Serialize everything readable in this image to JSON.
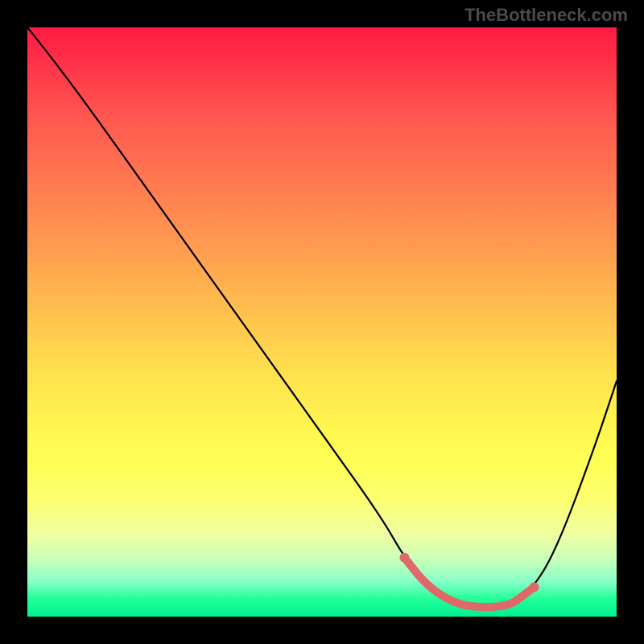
{
  "watermark": "TheBottleneck.com",
  "chart_data": {
    "type": "line",
    "title": "",
    "xlabel": "",
    "ylabel": "",
    "xlim": [
      0,
      100
    ],
    "ylim": [
      0,
      100
    ],
    "series": [
      {
        "name": "curve",
        "x": [
          0,
          4,
          10,
          20,
          30,
          40,
          50,
          60,
          64,
          68,
          73,
          78,
          82,
          86,
          90,
          96,
          100
        ],
        "y": [
          100,
          95,
          87,
          73,
          59,
          45,
          31,
          17,
          10,
          5,
          2,
          1.5,
          2,
          5,
          12,
          28,
          40
        ]
      },
      {
        "name": "highlight",
        "x": [
          64,
          68,
          73,
          78,
          82,
          84,
          86
        ],
        "y": [
          10,
          5,
          2,
          1.5,
          2,
          3.5,
          5
        ]
      }
    ],
    "gradient_bands": [
      "#ff1a44",
      "#ff7850",
      "#ffd94e",
      "#ffff55",
      "#00f090"
    ]
  }
}
